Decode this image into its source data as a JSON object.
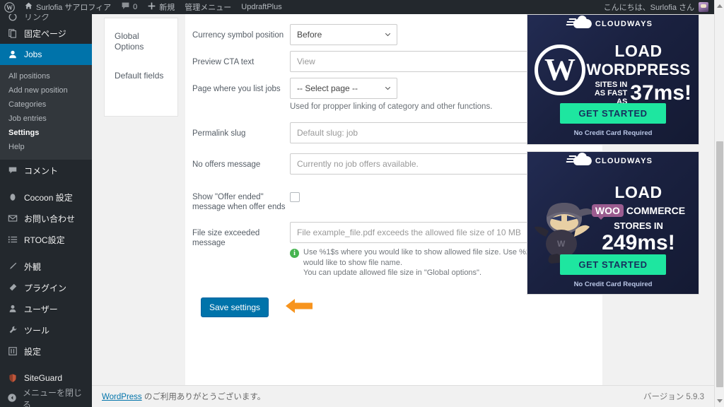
{
  "adminbar": {
    "logo_icon": "wordpress-logo-icon",
    "home_icon": "home-icon",
    "site_name": "Surlofia サアロフィア",
    "comment_icon": "comment-icon",
    "comment_count": "0",
    "new_icon": "plus-icon",
    "new_label": "新規",
    "admin_menu_label": "管理メニュー",
    "updraft_label": "UpdraftPlus",
    "greeting": "こんにちは、Surlofia さん",
    "avatar_name": "avatar"
  },
  "sidebar": {
    "partial_top_label": "リンク",
    "items": [
      {
        "label": "固定ページ",
        "icon": "pages-icon"
      },
      {
        "label": "Jobs",
        "icon": "jobs-user-icon",
        "current": true
      }
    ],
    "submenu": [
      {
        "label": "All positions",
        "active": false
      },
      {
        "label": "Add new position",
        "active": false
      },
      {
        "label": "Categories",
        "active": false
      },
      {
        "label": "Job entries",
        "active": false
      },
      {
        "label": "Settings",
        "active": true
      },
      {
        "label": "Help",
        "active": false
      }
    ],
    "items_after": [
      {
        "label": "コメント",
        "icon": "comment-icon"
      },
      {
        "label": "Cocoon 設定",
        "icon": "cocoon-icon",
        "gap_before": true
      },
      {
        "label": "お問い合わせ",
        "icon": "mail-icon"
      },
      {
        "label": "RTOC設定",
        "icon": "list-icon"
      },
      {
        "label": "外観",
        "icon": "appearance-brush-icon",
        "gap_before": true
      },
      {
        "label": "プラグイン",
        "icon": "plugins-icon"
      },
      {
        "label": "ユーザー",
        "icon": "users-icon"
      },
      {
        "label": "ツール",
        "icon": "tools-wrench-icon"
      },
      {
        "label": "設定",
        "icon": "settings-sliders-icon"
      },
      {
        "label": "SiteGuard",
        "icon": "siteguard-shield-icon",
        "gap_before": true
      }
    ],
    "collapse_label": "メニューを閉じる",
    "collapse_icon": "collapse-arrow-icon"
  },
  "subnav": {
    "items": [
      {
        "label": "Global Options"
      },
      {
        "label": "Default fields"
      }
    ]
  },
  "form": {
    "rows": [
      {
        "label": "Currency symbol position",
        "type": "select",
        "value": "Before"
      },
      {
        "label": "Preview CTA text",
        "type": "text",
        "value": "View"
      },
      {
        "label": "Page where you list jobs",
        "type": "select",
        "value": "-- Select page --",
        "helper": "Used for propper linking of category and other functions."
      },
      {
        "label": "Permalink slug",
        "type": "text",
        "value": "Default slug: job"
      },
      {
        "label": "No offers message",
        "type": "text",
        "value": "Currently no job offers available."
      },
      {
        "label": "Show \"Offer ended\" message when offer ends",
        "type": "checkbox",
        "checked": false
      },
      {
        "label": "File size exceeded message",
        "type": "text",
        "value": "File example_file.pdf exceeds the allowed file size of 10 MB",
        "note_icon": "info-icon",
        "note": "Use %1$s where you would like to show allowed file size. Use %2$s where you would like to show file name.\nYou can update allowed file size in \"Global options\"."
      }
    ],
    "save_label": "Save settings",
    "annotation_icon": "orange-left-arrow-annotation"
  },
  "ads": [
    {
      "brand": "CLOUDWAYS",
      "brand_icon": "cloudways-cloud-icon",
      "mark_icon": "wordpress-w-icon",
      "line1": "LOAD",
      "line2": "WORDPRESS",
      "line3_small": "SITES IN\nAS FAST AS",
      "line3_big": "37ms!",
      "cta": "GET STARTED",
      "note": "No Credit Card Required"
    },
    {
      "brand": "CLOUDWAYS",
      "brand_icon": "cloudways-cloud-icon",
      "mark_icon": "woo-ninja-icon",
      "line1": "LOAD",
      "badge": "WOO",
      "line2": "COMMERCE",
      "line3_small": "STORES IN",
      "line3_big": "249ms!",
      "cta": "GET STARTED",
      "note": "No Credit Card Required"
    }
  ],
  "footer": {
    "link": "WordPress",
    "text": " のご利用ありがとうございます。",
    "version": "バージョン 5.9.3"
  },
  "colors": {
    "wp_blue": "#0073aa",
    "sidebar_dark": "#23282d",
    "submenu_dark": "#32373c",
    "info_green": "#46b450",
    "annotation_orange": "#f7941e",
    "ad_cta_green": "#1ee6a0"
  }
}
